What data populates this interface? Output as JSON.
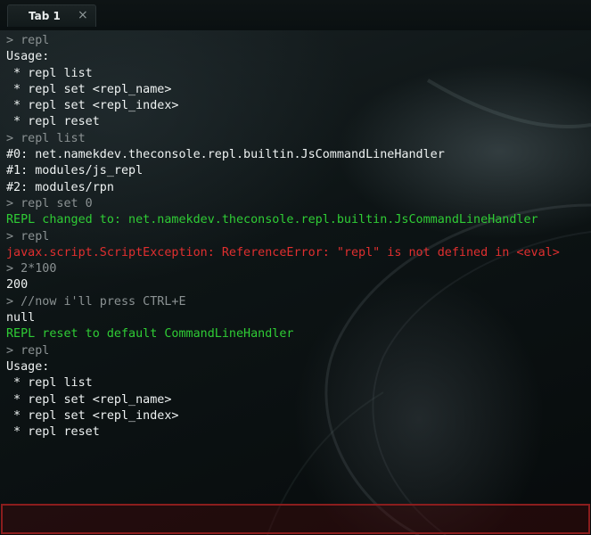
{
  "tabs": [
    {
      "label": "Tab 1",
      "close_glyph": "×",
      "active": true
    }
  ],
  "console": {
    "lines": [
      {
        "kind": "input",
        "text": "> repl"
      },
      {
        "kind": "output",
        "text": "Usage:"
      },
      {
        "kind": "output",
        "text": " * repl list"
      },
      {
        "kind": "output",
        "text": " * repl set <repl_name>"
      },
      {
        "kind": "output",
        "text": " * repl set <repl_index>"
      },
      {
        "kind": "output",
        "text": " * repl reset"
      },
      {
        "kind": "input",
        "text": "> repl list"
      },
      {
        "kind": "output",
        "text": "#0: net.namekdev.theconsole.repl.builtin.JsCommandLineHandler"
      },
      {
        "kind": "output",
        "text": "#1: modules/js_repl"
      },
      {
        "kind": "output",
        "text": "#2: modules/rpn"
      },
      {
        "kind": "input",
        "text": "> repl set 0"
      },
      {
        "kind": "success",
        "text": "REPL changed to: net.namekdev.theconsole.repl.builtin.JsCommandLineHandler"
      },
      {
        "kind": "input",
        "text": "> repl"
      },
      {
        "kind": "error",
        "text": "javax.script.ScriptException: ReferenceError: \"repl\" is not defined in <eval>"
      },
      {
        "kind": "input",
        "text": "> 2*100"
      },
      {
        "kind": "output",
        "text": "200"
      },
      {
        "kind": "input",
        "text": "> //now i'll press CTRL+E"
      },
      {
        "kind": "output",
        "text": "null"
      },
      {
        "kind": "success",
        "text": "REPL reset to default CommandLineHandler"
      },
      {
        "kind": "input",
        "text": "> repl"
      },
      {
        "kind": "output",
        "text": "Usage:"
      },
      {
        "kind": "output",
        "text": " * repl list"
      },
      {
        "kind": "output",
        "text": " * repl set <repl_name>"
      },
      {
        "kind": "output",
        "text": " * repl set <repl_index>"
      },
      {
        "kind": "output",
        "text": " * repl reset"
      }
    ]
  },
  "command_input": {
    "value": ""
  },
  "colors": {
    "input_echo": "#8b9293",
    "output": "#eef2f2",
    "success": "#2fcc35",
    "error": "#e02f2f",
    "input_border": "#8b1d1d"
  }
}
